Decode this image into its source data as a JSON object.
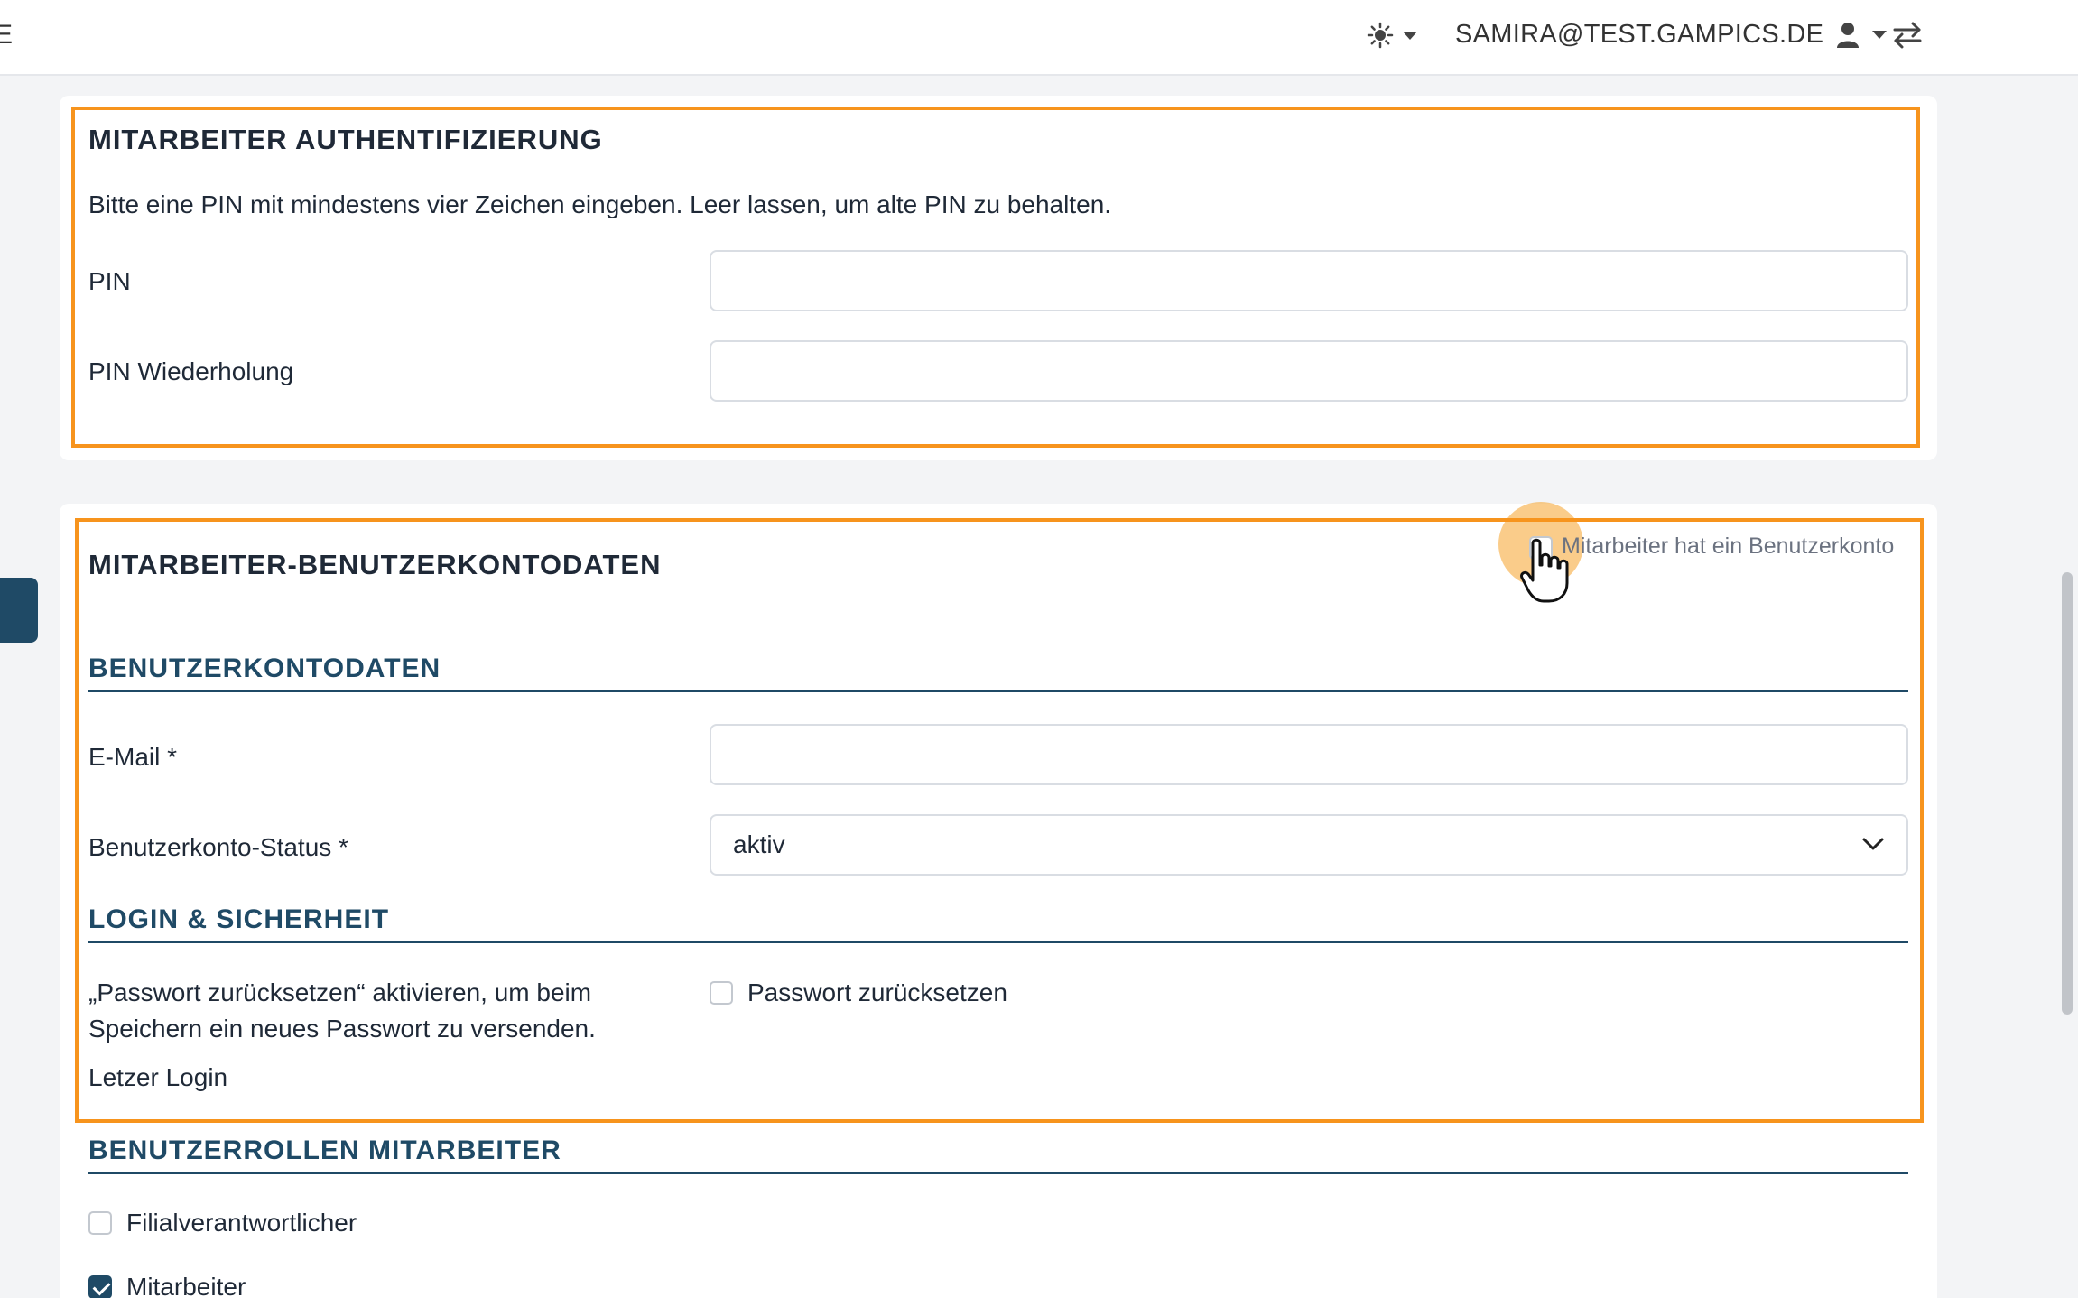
{
  "topbar": {
    "cut_letter": "E",
    "email": "SAMIRA@TEST.GAMPICS.DE"
  },
  "auth": {
    "title": "MITARBEITER AUTHENTIFIZIERUNG",
    "help": "Bitte eine PIN mit mindestens vier Zeichen eingeben. Leer lassen, um alte PIN zu behalten.",
    "pin_label": "PIN",
    "pin_value": "",
    "pin_repeat_label": "PIN Wiederholung",
    "pin_repeat_value": ""
  },
  "account": {
    "title": "MITARBEITER-BENUTZERKONTODATEN",
    "has_account_label": "Mitarbeiter hat ein Benutzerkonto",
    "section_data": "BENUTZERKONTODATEN",
    "email_label": "E-Mail *",
    "email_value": "",
    "status_label": "Benutzerkonto-Status *",
    "status_value": "aktiv",
    "section_login": "LOGIN & SICHERHEIT",
    "reset_help_line1": "„Passwort zurücksetzen“ aktivieren, um beim",
    "reset_help_line2": "Speichern ein neues Passwort zu versenden.",
    "reset_label": "Passwort zurücksetzen",
    "last_login_label": "Letzer Login"
  },
  "roles": {
    "section": "BENUTZERROLLEN MITARBEITER",
    "items": [
      {
        "label": "Filialverantwortlicher",
        "checked": false
      },
      {
        "label": "Mitarbeiter",
        "checked": true
      }
    ]
  },
  "colors": {
    "accent": "#1f4a66",
    "highlight": "#f7941d"
  }
}
